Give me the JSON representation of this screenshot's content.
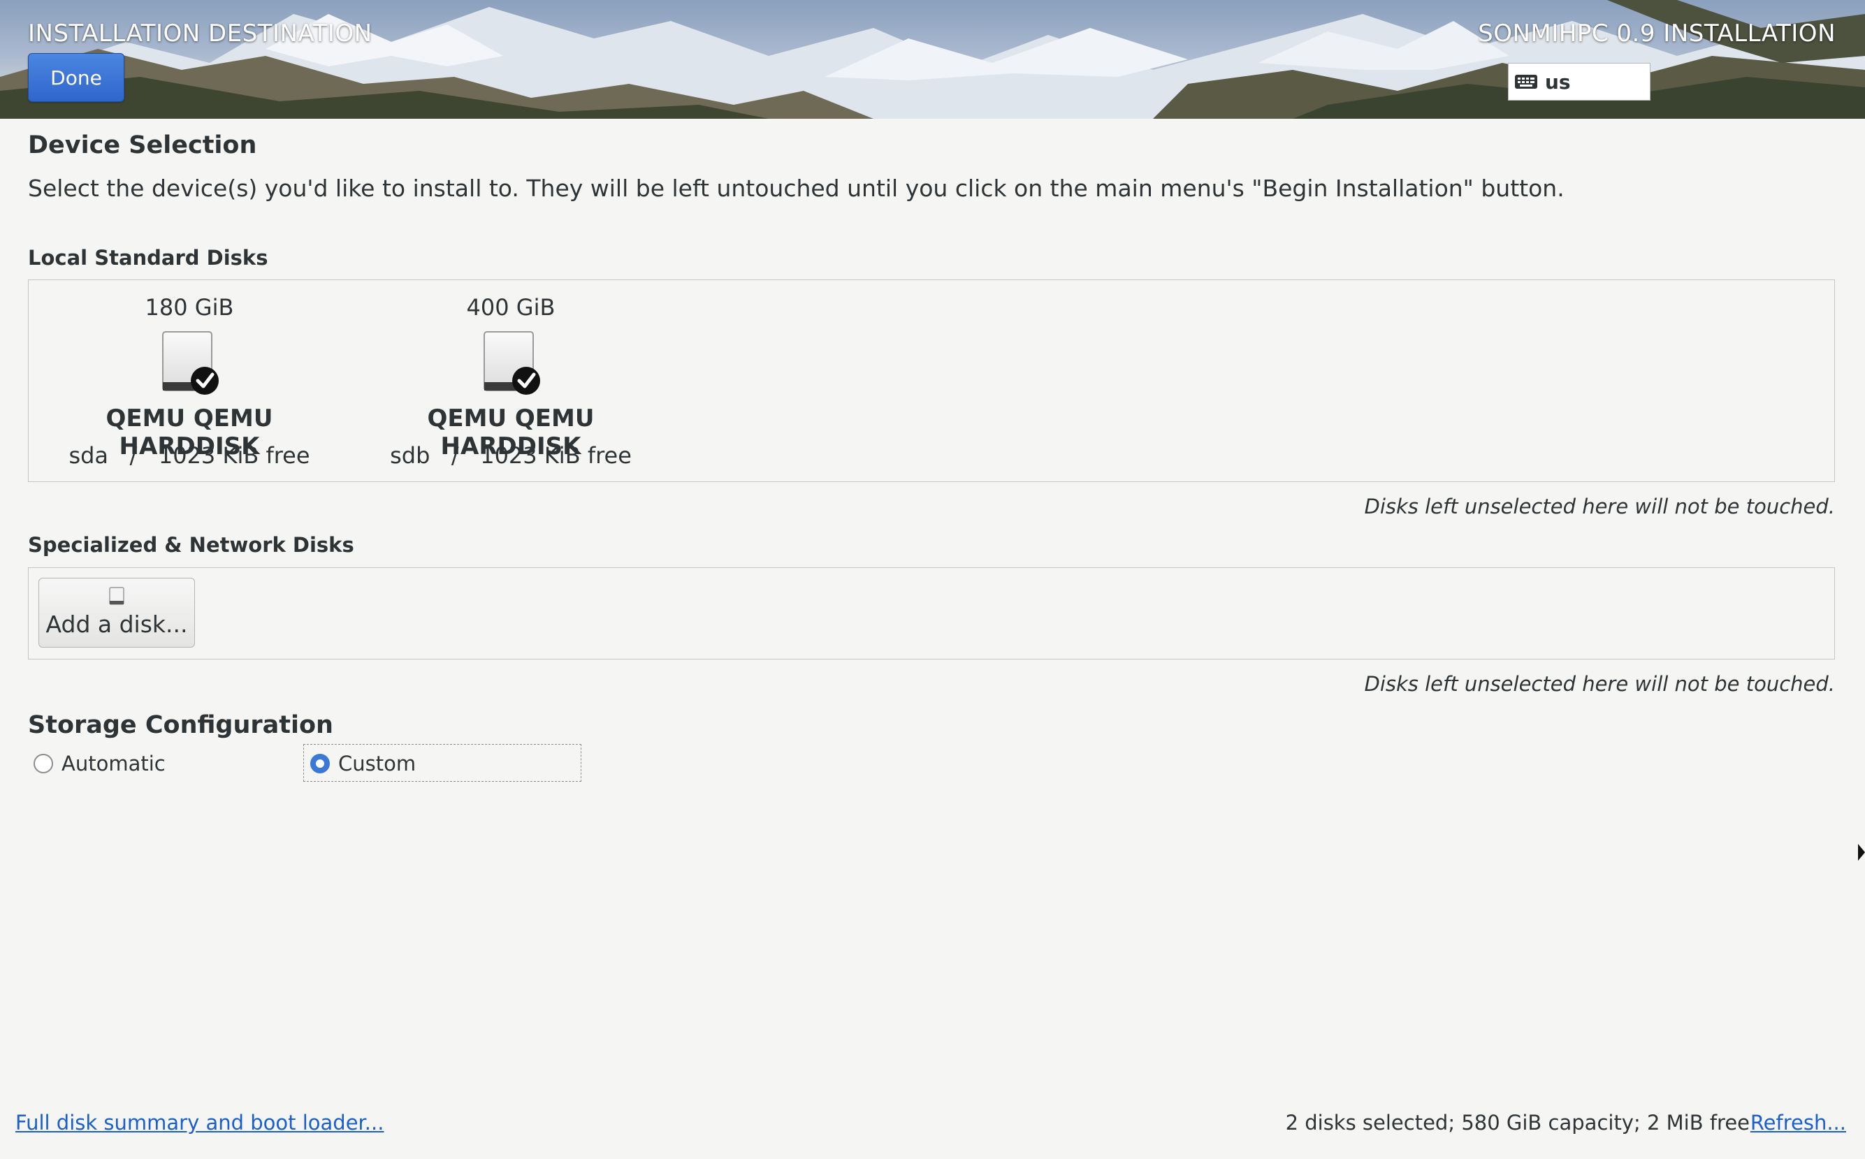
{
  "header": {
    "title": "INSTALLATION DESTINATION",
    "product": "SONMIHPC 0.9 INSTALLATION",
    "done_label": "Done",
    "keyboard_layout": "us",
    "keyboard_icon": "keyboard-icon"
  },
  "device_selection": {
    "title": "Device Selection",
    "description": "Select the device(s) you'd like to install to.  They will be left untouched until you click on the main menu's \"Begin Installation\" button."
  },
  "local_disks": {
    "title": "Local Standard Disks",
    "disks": [
      {
        "size": "180 GiB",
        "model": "QEMU QEMU HARDDISK",
        "info": "sda   /   1023 KiB free",
        "selected": true,
        "icon": "harddisk-icon"
      },
      {
        "size": "400 GiB",
        "model": "QEMU QEMU HARDDISK",
        "info": "sdb   /   1023 KiB free",
        "selected": true,
        "icon": "harddisk-icon"
      }
    ],
    "note": "Disks left unselected here will not be touched."
  },
  "network_disks": {
    "title": "Specialized & Network Disks",
    "add_label": "Add a disk...",
    "note": "Disks left unselected here will not be touched."
  },
  "storage": {
    "title": "Storage Configuration",
    "options": [
      {
        "label": "Automatic",
        "selected": false
      },
      {
        "label": "Custom",
        "selected": true
      }
    ]
  },
  "footer": {
    "summary_link": "Full disk summary and boot loader...",
    "status": "2 disks selected; 580 GiB capacity; 2 MiB free",
    "refresh_link": "Refresh..."
  },
  "colors": {
    "accent": "#3b78d8",
    "done_button": "#3a72d6",
    "link": "#1a5fd1"
  }
}
